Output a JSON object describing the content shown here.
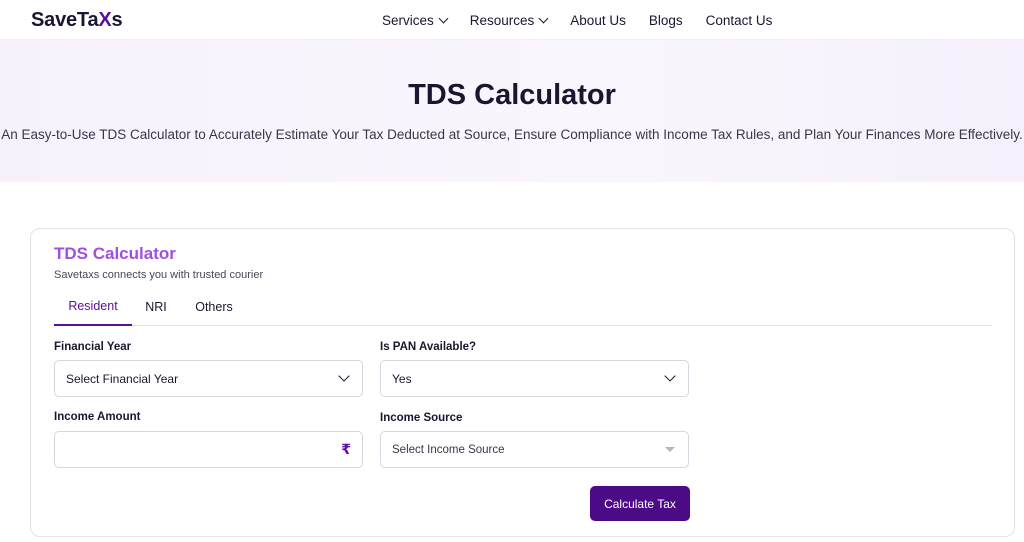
{
  "nav": {
    "logo_prefix": "SaveTa",
    "logo_x": "X",
    "logo_suffix": "s",
    "items": [
      {
        "label": "Services"
      },
      {
        "label": "Resources"
      },
      {
        "label": "About Us"
      },
      {
        "label": "Blogs"
      },
      {
        "label": "Contact Us"
      }
    ]
  },
  "hero": {
    "title": "TDS Calculator",
    "subtitle": "An Easy-to-Use TDS Calculator to Accurately Estimate Your Tax Deducted at Source, Ensure Compliance with Income Tax Rules, and Plan Your Finances More Effectively."
  },
  "calculator": {
    "title": "TDS Calculator",
    "subtitle": "Savetaxs connects you with trusted courier",
    "tabs": [
      {
        "label": "Resident",
        "active": true
      },
      {
        "label": "NRI",
        "active": false
      },
      {
        "label": "Others",
        "active": false
      }
    ],
    "fields": {
      "financial_year": {
        "label": "Financial Year",
        "value": "Select Financial Year"
      },
      "pan_available": {
        "label": "Is PAN Available?",
        "value": "Yes"
      },
      "income_amount": {
        "label": "Income Amount",
        "value": "",
        "currency_symbol": "₹"
      },
      "income_source": {
        "label": "Income Source",
        "value": "Select Income Source"
      }
    },
    "submit_label": "Calculate Tax"
  },
  "colors": {
    "brand": "#5b0f9c",
    "button": "#4d0a87",
    "card_title": "#a14fe0"
  }
}
